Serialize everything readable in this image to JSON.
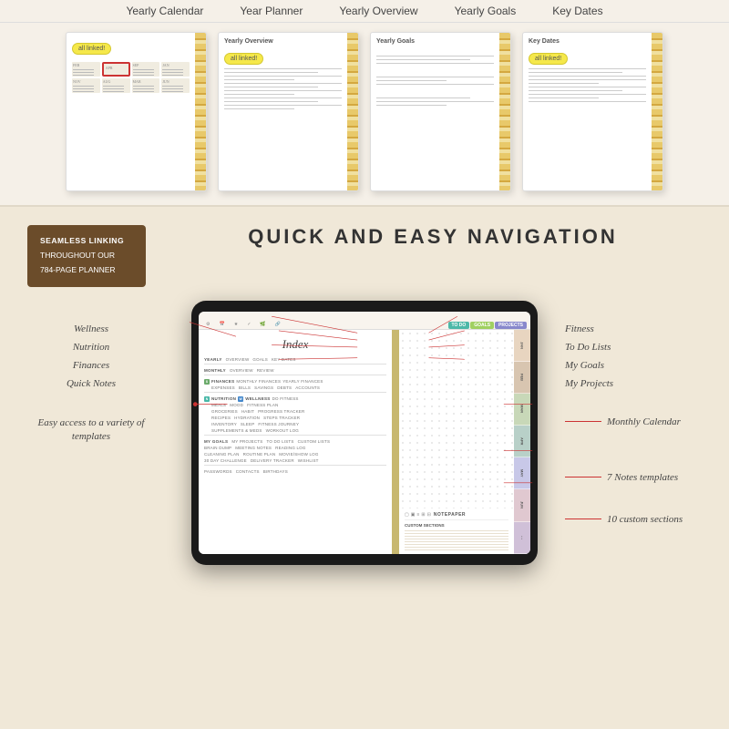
{
  "topNav": {
    "items": [
      "Yearly Calendar",
      "Year Planner",
      "Yearly Overview",
      "Yearly Goals",
      "Key Dates"
    ]
  },
  "previewCards": [
    {
      "id": "yearly-calendar",
      "badge": "all linked!",
      "type": "calendar"
    },
    {
      "id": "yearly-overview",
      "title": "Yearly Overview",
      "badge": "all linked!",
      "type": "lined"
    },
    {
      "id": "yearly-goals",
      "title": "Yearly Goals",
      "badge": null,
      "type": "lined"
    },
    {
      "id": "key-dates",
      "title": "Key Dates",
      "badge": "all linked!",
      "type": "lined"
    }
  ],
  "seamlessBox": {
    "line1": "SEAMLESS LINKING",
    "line2": "THROUGHOUT OUR",
    "line3": "784-PAGE PLANNER"
  },
  "navHeading": "QUICK AND EASY NAVIGATION",
  "annotations": {
    "left": "Easy access to a variety of templates",
    "navItems": [
      "Wellness",
      "Nutrition",
      "Finances",
      "Quick Notes",
      "Fitness",
      "To Do Lists",
      "My Goals",
      "My Projects"
    ],
    "rightItems": [
      "Monthly Calendar",
      "7 Notes templates",
      "10 custom sections"
    ]
  },
  "tablet": {
    "tabs": [
      "TO DO",
      "GOALS",
      "PROJECTS"
    ],
    "indexTitle": "Index",
    "sections": {
      "yearly": [
        "YEARLY",
        "OVERVIEW",
        "GOALS",
        "KEY DATES"
      ],
      "monthly": [
        "MONTHLY",
        "OVERVIEW",
        "REVIEW"
      ],
      "finances": [
        "FINANCES",
        "MONTHLY FINANCES",
        "YEARLY FINANCES",
        "EXPENSES",
        "BILLS",
        "SAVINGS",
        "DEBTS",
        "ACCOUNTS"
      ],
      "nutrition": [
        "NUTRITION",
        "WELLNESS",
        "DO FITNESS"
      ],
      "nutritionRows": [
        "MEALS",
        "MOOD",
        "FITNESS PLAN",
        "GROCERIES",
        "HABIT",
        "PROGRESS TRACKER",
        "RECIPES",
        "HYDRATION",
        "STEPS TRACKER",
        "INVENTORY",
        "SLEEP",
        "FITNESS JOURNEY",
        "SUPPLEMENTS & MEDS",
        "WORKOUT LOG"
      ],
      "goals": [
        "MY GOALS",
        "MY PROJECTS",
        "TO DO LISTS",
        "CUSTOM LISTS"
      ],
      "planning": [
        "BRAIN DUMP",
        "MEETING NOTES",
        "READING LOG",
        "CLEANING PLAN",
        "ROUTINE PLAN",
        "MOVIE/SHOW LOG",
        "30 DAY CHALLENGE",
        "DELIVERY TRACKER",
        "WISHLIST"
      ],
      "other": [
        "PASSWORDS",
        "CONTACTS",
        "BIRTHDAYS"
      ]
    }
  },
  "colors": {
    "accent": "#cc3333",
    "brown": "#6b4c2a",
    "gold": "#e8c840",
    "background": "#f0e8d8"
  }
}
